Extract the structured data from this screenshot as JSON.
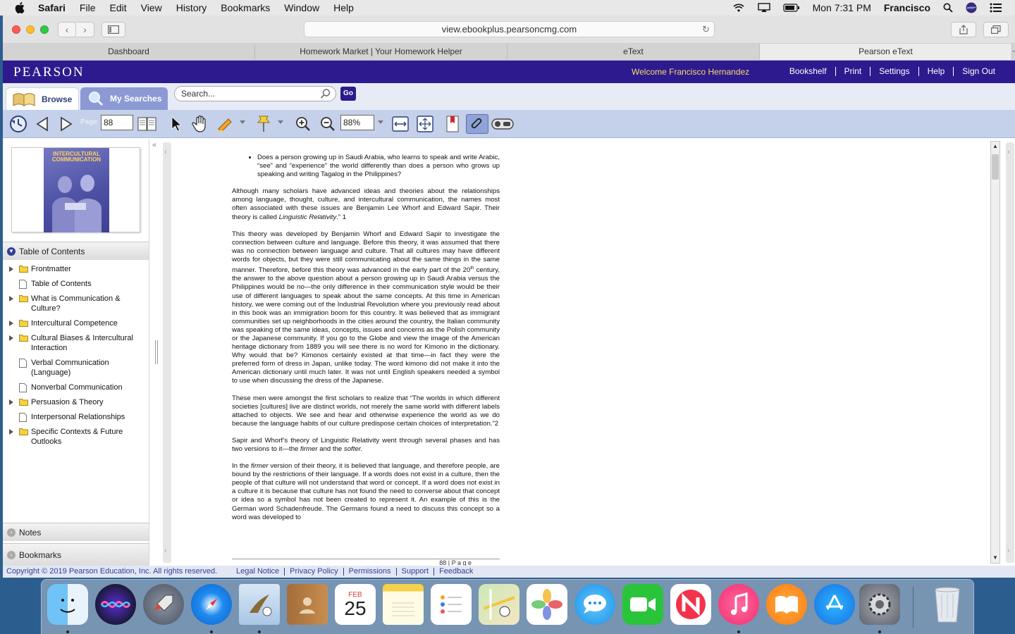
{
  "menubar": {
    "items": [
      "Safari",
      "File",
      "Edit",
      "View",
      "History",
      "Bookmarks",
      "Window",
      "Help"
    ],
    "clock": "Mon 7:31 PM",
    "user": "Francisco"
  },
  "browser": {
    "url": "view.ebookplus.pearsoncmg.com",
    "tabs": [
      "Dashboard",
      "Homework Market | Your Homework Helper",
      "eText",
      "Pearson eText"
    ],
    "active_tab": 3
  },
  "pearson": {
    "logo": "PEARSON",
    "welcome": "Welcome Francisco Hernandez",
    "links": [
      "Bookshelf",
      "Print",
      "Settings",
      "Help",
      "Sign Out"
    ],
    "tab_browse": "Browse",
    "tab_searches": "My Searches",
    "search_placeholder": "Search...",
    "go_label": "Go",
    "page_label": "Page",
    "page_number": "88",
    "zoom": "88%",
    "accent": "#2d1a8e",
    "welcome_color": "#f6dc6b"
  },
  "sidebar": {
    "cover_title": "INTERCULTURAL COMMUNICATION",
    "toc_title": "Table of Contents",
    "toc": [
      {
        "label": "Frontmatter",
        "type": "folder"
      },
      {
        "label": "Table of Contents",
        "type": "page"
      },
      {
        "label": "What is Communication & Culture?",
        "type": "folder"
      },
      {
        "label": "Intercultural Competence",
        "type": "folder"
      },
      {
        "label": "Cultural Biases & Intercultural Interaction",
        "type": "folder"
      },
      {
        "label": "Verbal Communication (Language)",
        "type": "page"
      },
      {
        "label": "Nonverbal Communication",
        "type": "page"
      },
      {
        "label": "Persuasion & Theory",
        "type": "folder"
      },
      {
        "label": "Interpersonal Relationships",
        "type": "page"
      },
      {
        "label": "Specific Contexts & Future Outlooks",
        "type": "folder"
      }
    ],
    "notes": "Notes",
    "bookmarks": "Bookmarks"
  },
  "page": {
    "bullet": "Does a person growing up in Saudi Arabia, who learns to speak and write Arabic, “see” and “experience” the world differently than does a person who grows up speaking and writing Tagalog in the Philippines?",
    "p1a": "Although many scholars have advanced ideas and theories about the relationships among language, thought, culture, and intercultural communication, the names most often associated with these issues are Benjamin Lee Whorf and Edward Sapir. Their theory is called ",
    "p1_em": "Linguistic Relativity",
    "p1b": ".” 1",
    "p2a": "This theory was developed by Benjamin Whorf and Edward Sapir to investigate the connection between culture and language. Before this theory, it was assumed that there was no connection between language and culture.  That all cultures may have different words for objects, but they were still communicating about the same things in the same manner. Therefore, before this theory was advanced in the early part of the 20",
    "p2_sup": "th",
    "p2b": " century, the answer to the above question about a person growing up in Saudi Arabia versus the Philippines would be no—the only difference in their communication style would be their use of different languages to speak about the same concepts. At this time in American history, we were coming out of the Industrial Revolution where you previously read about in this book was an immigration boom for this country.  It was believed that as immigrant communities set up neighborhoods in the cities around the country, the Italian community was speaking of the same ideas, concepts, issues and concerns as the Polish community or the Japanese community.  If you go to the Globe and view the image of the American heritage dictionary from 1889 you will see there is no word for Kimono in the dictionary.  Why would that be?  Kimonos certainly existed at that time—in fact they were the preferred form of dress in Japan, unlike today.  The word kimono did not make it into the American dictionary until much later.  It was not until English speakers needed a symbol to use when discussing the dress of the Japanese.",
    "p3": "These men were amongst the first scholars to realize that “The worlds in which different societies [cultures] live are distinct worlds, not merely the same world with different labels attached to objects.  We see and hear and otherwise experience the world as we do because the language habits of our culture predispose certain choices of interpretation.”2",
    "p4a": "Sapir and Whorf’s theory of Linguistic Relativity went through several phases and has two versions to it—the ",
    "p4_em1": "firmer",
    "p4_mid": " and the ",
    "p4_em2": "softer.",
    "p5a": "In the ",
    "p5_em": "firmer",
    "p5b": " version of their theory, it is believed that language, and therefore people, are bound by the restrictions of their language. If a words does not exist in a culture, then the people of that culture will not understand that word or concept.  If a word does not exist in a culture it is because that culture has not found the need to converse about that concept or idea so a symbol has not been created to represent it.  An example of this is the German word Schadenfreude.  The Germans found a need to discuss this concept so a word was developed to",
    "footer_num": "88 | P a g e"
  },
  "footer": {
    "copyright": "Copyright © 2019 Pearson Education, Inc. All rights reserved.",
    "links": [
      "Legal Notice",
      "Privacy Policy",
      "Permissions",
      "Support",
      "Feedback"
    ]
  },
  "dock": {
    "calendar_month": "FEB",
    "calendar_day": "25"
  }
}
